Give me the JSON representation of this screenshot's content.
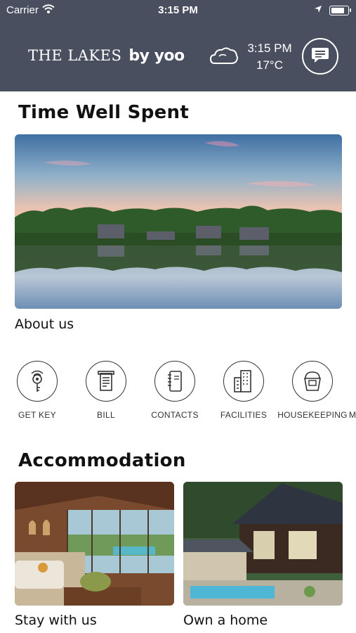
{
  "status_bar": {
    "carrier": "Carrier",
    "time": "3:15 PM"
  },
  "header": {
    "logo_main": "THE LAKES",
    "logo_sub": "by yoo",
    "weather_icon": "cloud-icon",
    "weather_time": "3:15 PM",
    "temperature": "17°C",
    "chat_icon": "chat-icon"
  },
  "sections": {
    "time_well_spent": {
      "title": "Time Well Spent",
      "hero_caption": "About us"
    },
    "services": [
      {
        "label": "GET KEY",
        "icon": "key-icon"
      },
      {
        "label": "BILL",
        "icon": "bill-icon"
      },
      {
        "label": "CONTACTS",
        "icon": "contacts-icon"
      },
      {
        "label": "FACILITIES",
        "icon": "building-icon"
      },
      {
        "label": "HOUSEKEEPING",
        "icon": "bucket-icon"
      },
      {
        "label": "M",
        "icon": ""
      }
    ],
    "accommodation": {
      "title": "Accommodation",
      "cards": [
        {
          "label": "Stay with us"
        },
        {
          "label": "Own a home"
        }
      ]
    }
  },
  "colors": {
    "header_bg": "#4a4f60",
    "text": "#111111"
  }
}
